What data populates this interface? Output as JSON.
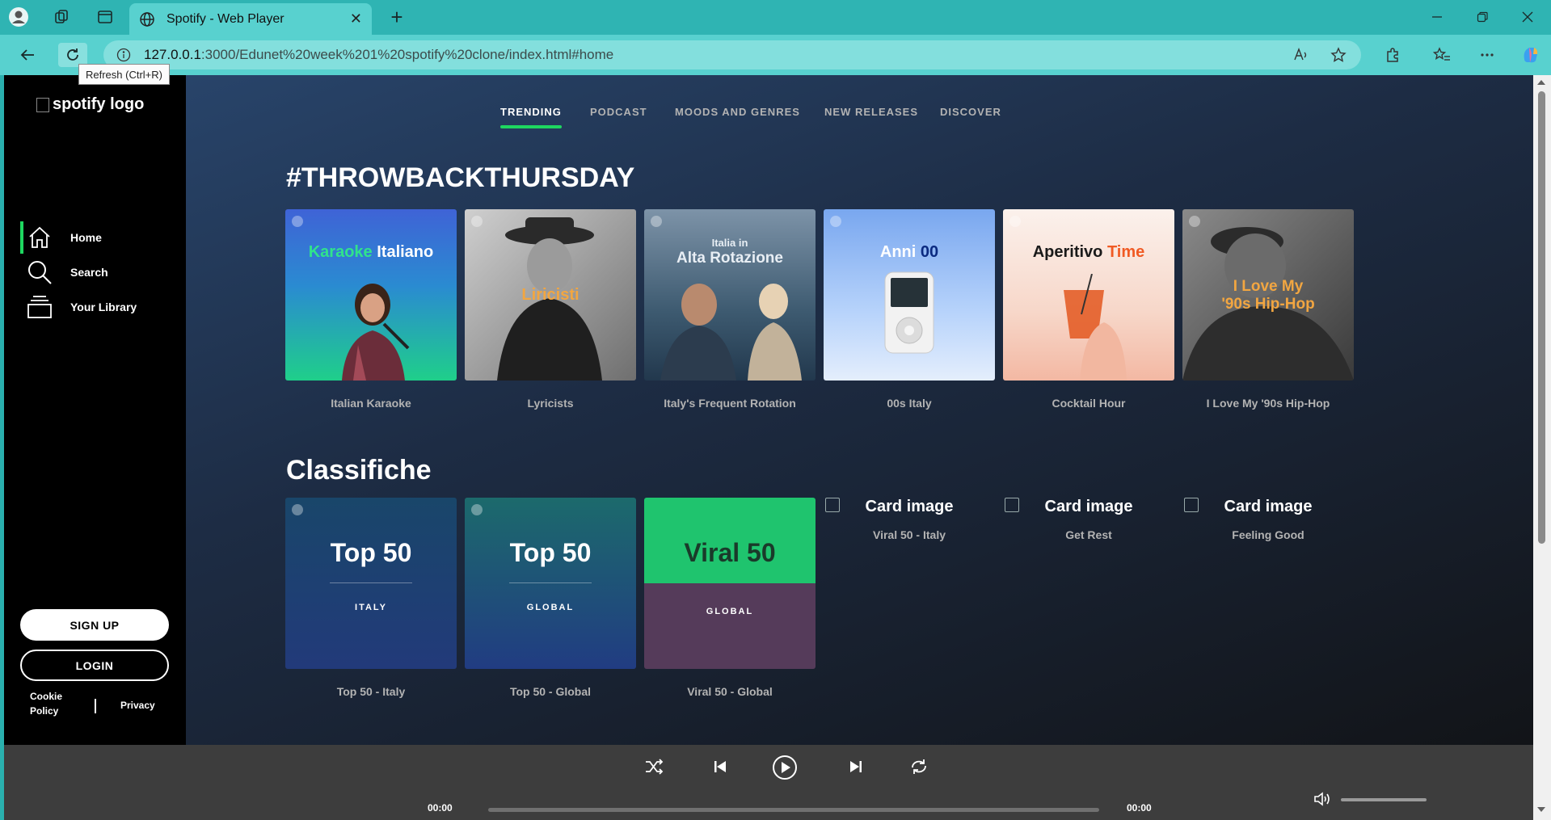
{
  "browser": {
    "tab_title": "Spotify - Web Player",
    "url_host": "127.0.0.1",
    "url_path": ":3000/Edunet%20week%201%20spotify%20clone/index.html#home",
    "tooltip": "Refresh (Ctrl+R)"
  },
  "sidebar": {
    "logo_alt": "spotify logo",
    "nav": [
      {
        "label": "Home",
        "icon": "home-icon"
      },
      {
        "label": "Search",
        "icon": "search-icon"
      },
      {
        "label": "Your Library",
        "icon": "library-icon"
      }
    ],
    "signup": "SIGN UP",
    "login": "LOGIN",
    "cookie_1": "Cookie",
    "cookie_2": "Policy",
    "privacy": "Privacy"
  },
  "topnav": [
    "TRENDING",
    "PODCAST",
    "MOODS AND GENRES",
    "NEW RELEASES",
    "DISCOVER"
  ],
  "sections": {
    "throwback": {
      "title": "#THROWBACKTHURSDAY",
      "cards": [
        {
          "caption": "Italian Karaoke",
          "art_a": "Karaoke",
          "art_b": " Italiano"
        },
        {
          "caption": "Lyricists",
          "art_text": "Liricisti"
        },
        {
          "caption": "Italy's Frequent Rotation",
          "art_a": "Italia in",
          "art_b": "Alta Rotazione"
        },
        {
          "caption": "00s Italy",
          "art_a": "Anni ",
          "art_b": "00"
        },
        {
          "caption": "Cocktail Hour",
          "art_a": "Aperitivo ",
          "art_b": "Time"
        },
        {
          "caption": "I Love My '90s Hip-Hop",
          "art_a": "I Love My",
          "art_b": "'90s Hip-Hop"
        }
      ]
    },
    "charts": {
      "title": "Classifiche",
      "cards": [
        {
          "caption": "Top 50 - Italy",
          "big": "Top 50",
          "small": "ITALY"
        },
        {
          "caption": "Top 50 - Global",
          "big": "Top 50",
          "small": "GLOBAL"
        },
        {
          "caption": "Viral 50 - Global",
          "big": "Viral 50",
          "small": "GLOBAL"
        },
        {
          "caption": "Viral 50 - Italy",
          "alt": "Card image"
        },
        {
          "caption": "Get Rest",
          "alt": "Card image"
        },
        {
          "caption": "Feeling Good",
          "alt": "Card image"
        }
      ]
    }
  },
  "player": {
    "time_current": "00:00",
    "time_total": "00:00",
    "progress": 0
  },
  "colors": {
    "accent": "#1ed760",
    "sidebar": "#000000",
    "player": "#3d3d3d"
  }
}
